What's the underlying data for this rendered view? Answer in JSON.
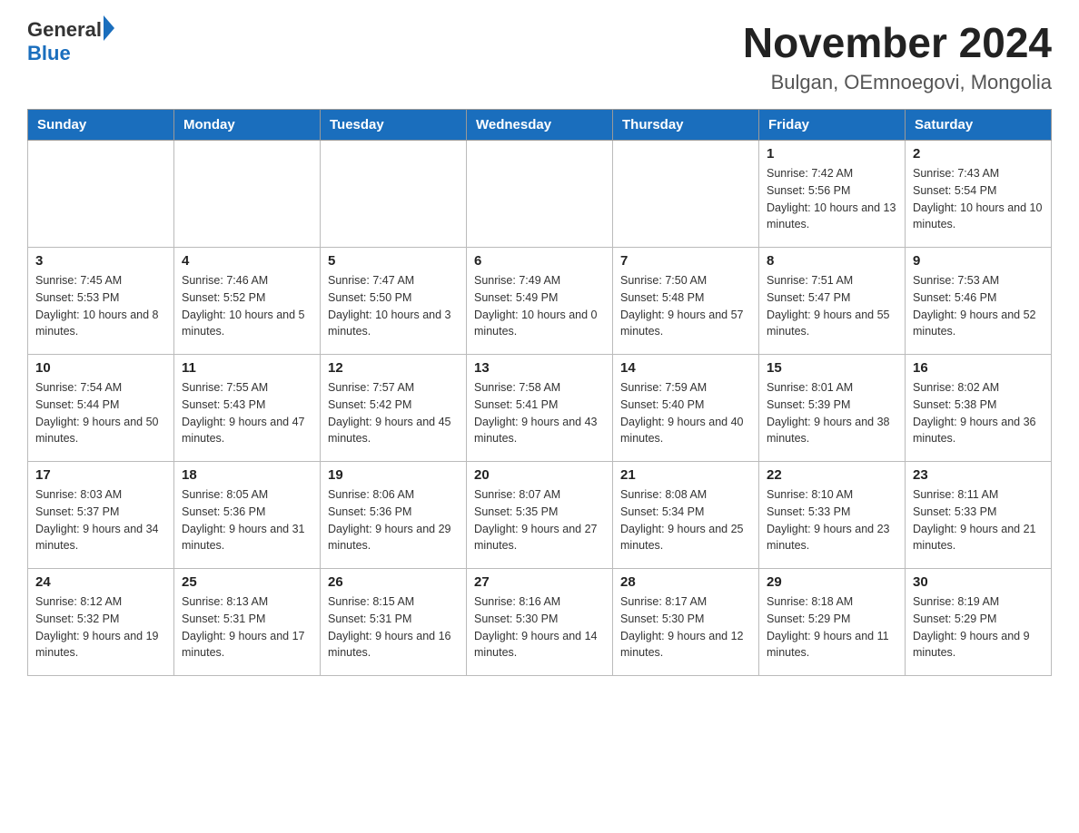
{
  "header": {
    "logo_general": "General",
    "logo_blue": "Blue",
    "main_title": "November 2024",
    "subtitle": "Bulgan, OEmnoegovi, Mongolia"
  },
  "days_of_week": [
    "Sunday",
    "Monday",
    "Tuesday",
    "Wednesday",
    "Thursday",
    "Friday",
    "Saturday"
  ],
  "weeks": [
    [
      {
        "day": "",
        "info": ""
      },
      {
        "day": "",
        "info": ""
      },
      {
        "day": "",
        "info": ""
      },
      {
        "day": "",
        "info": ""
      },
      {
        "day": "",
        "info": ""
      },
      {
        "day": "1",
        "info": "Sunrise: 7:42 AM\nSunset: 5:56 PM\nDaylight: 10 hours and 13 minutes."
      },
      {
        "day": "2",
        "info": "Sunrise: 7:43 AM\nSunset: 5:54 PM\nDaylight: 10 hours and 10 minutes."
      }
    ],
    [
      {
        "day": "3",
        "info": "Sunrise: 7:45 AM\nSunset: 5:53 PM\nDaylight: 10 hours and 8 minutes."
      },
      {
        "day": "4",
        "info": "Sunrise: 7:46 AM\nSunset: 5:52 PM\nDaylight: 10 hours and 5 minutes."
      },
      {
        "day": "5",
        "info": "Sunrise: 7:47 AM\nSunset: 5:50 PM\nDaylight: 10 hours and 3 minutes."
      },
      {
        "day": "6",
        "info": "Sunrise: 7:49 AM\nSunset: 5:49 PM\nDaylight: 10 hours and 0 minutes."
      },
      {
        "day": "7",
        "info": "Sunrise: 7:50 AM\nSunset: 5:48 PM\nDaylight: 9 hours and 57 minutes."
      },
      {
        "day": "8",
        "info": "Sunrise: 7:51 AM\nSunset: 5:47 PM\nDaylight: 9 hours and 55 minutes."
      },
      {
        "day": "9",
        "info": "Sunrise: 7:53 AM\nSunset: 5:46 PM\nDaylight: 9 hours and 52 minutes."
      }
    ],
    [
      {
        "day": "10",
        "info": "Sunrise: 7:54 AM\nSunset: 5:44 PM\nDaylight: 9 hours and 50 minutes."
      },
      {
        "day": "11",
        "info": "Sunrise: 7:55 AM\nSunset: 5:43 PM\nDaylight: 9 hours and 47 minutes."
      },
      {
        "day": "12",
        "info": "Sunrise: 7:57 AM\nSunset: 5:42 PM\nDaylight: 9 hours and 45 minutes."
      },
      {
        "day": "13",
        "info": "Sunrise: 7:58 AM\nSunset: 5:41 PM\nDaylight: 9 hours and 43 minutes."
      },
      {
        "day": "14",
        "info": "Sunrise: 7:59 AM\nSunset: 5:40 PM\nDaylight: 9 hours and 40 minutes."
      },
      {
        "day": "15",
        "info": "Sunrise: 8:01 AM\nSunset: 5:39 PM\nDaylight: 9 hours and 38 minutes."
      },
      {
        "day": "16",
        "info": "Sunrise: 8:02 AM\nSunset: 5:38 PM\nDaylight: 9 hours and 36 minutes."
      }
    ],
    [
      {
        "day": "17",
        "info": "Sunrise: 8:03 AM\nSunset: 5:37 PM\nDaylight: 9 hours and 34 minutes."
      },
      {
        "day": "18",
        "info": "Sunrise: 8:05 AM\nSunset: 5:36 PM\nDaylight: 9 hours and 31 minutes."
      },
      {
        "day": "19",
        "info": "Sunrise: 8:06 AM\nSunset: 5:36 PM\nDaylight: 9 hours and 29 minutes."
      },
      {
        "day": "20",
        "info": "Sunrise: 8:07 AM\nSunset: 5:35 PM\nDaylight: 9 hours and 27 minutes."
      },
      {
        "day": "21",
        "info": "Sunrise: 8:08 AM\nSunset: 5:34 PM\nDaylight: 9 hours and 25 minutes."
      },
      {
        "day": "22",
        "info": "Sunrise: 8:10 AM\nSunset: 5:33 PM\nDaylight: 9 hours and 23 minutes."
      },
      {
        "day": "23",
        "info": "Sunrise: 8:11 AM\nSunset: 5:33 PM\nDaylight: 9 hours and 21 minutes."
      }
    ],
    [
      {
        "day": "24",
        "info": "Sunrise: 8:12 AM\nSunset: 5:32 PM\nDaylight: 9 hours and 19 minutes."
      },
      {
        "day": "25",
        "info": "Sunrise: 8:13 AM\nSunset: 5:31 PM\nDaylight: 9 hours and 17 minutes."
      },
      {
        "day": "26",
        "info": "Sunrise: 8:15 AM\nSunset: 5:31 PM\nDaylight: 9 hours and 16 minutes."
      },
      {
        "day": "27",
        "info": "Sunrise: 8:16 AM\nSunset: 5:30 PM\nDaylight: 9 hours and 14 minutes."
      },
      {
        "day": "28",
        "info": "Sunrise: 8:17 AM\nSunset: 5:30 PM\nDaylight: 9 hours and 12 minutes."
      },
      {
        "day": "29",
        "info": "Sunrise: 8:18 AM\nSunset: 5:29 PM\nDaylight: 9 hours and 11 minutes."
      },
      {
        "day": "30",
        "info": "Sunrise: 8:19 AM\nSunset: 5:29 PM\nDaylight: 9 hours and 9 minutes."
      }
    ]
  ]
}
